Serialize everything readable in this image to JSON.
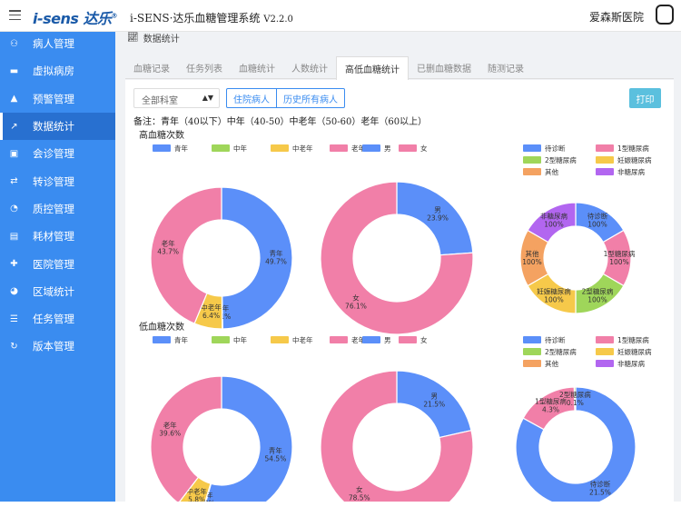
{
  "header": {
    "logo_text": "i-sens",
    "logo_cn": "达乐",
    "app_title": "i-SENS·达乐血糖管理系统",
    "version": "V2.2.0",
    "hospital": "爱森斯医院"
  },
  "sidebar": {
    "items": [
      {
        "label": "病人管理",
        "icon": "users-icon"
      },
      {
        "label": "虚拟病房",
        "icon": "bed-icon"
      },
      {
        "label": "预警管理",
        "icon": "bell-icon"
      },
      {
        "label": "数据统计",
        "icon": "chart-line-icon",
        "active": true
      },
      {
        "label": "会诊管理",
        "icon": "briefcase-icon"
      },
      {
        "label": "转诊管理",
        "icon": "exchange-icon"
      },
      {
        "label": "质控管理",
        "icon": "gauge-icon"
      },
      {
        "label": "耗材管理",
        "icon": "box-icon"
      },
      {
        "label": "医院管理",
        "icon": "hospital-icon"
      },
      {
        "label": "区域统计",
        "icon": "pie-icon"
      },
      {
        "label": "任务管理",
        "icon": "list-icon"
      },
      {
        "label": "版本管理",
        "icon": "refresh-icon"
      }
    ]
  },
  "breadcrumb": "数据统计",
  "tabs": [
    "血糖记录",
    "任务列表",
    "血糖统计",
    "人数统计",
    "高低血糖统计",
    "已删血糖数据",
    "随测记录"
  ],
  "active_tab": 4,
  "filters": {
    "dept_select": "全部科室",
    "btn_inpatient": "住院病人",
    "btn_history": "历史所有病人",
    "btn_print": "打印"
  },
  "note": "备注：青年（40以下）中年（40-50）中老年（50-60）老年（60以上）",
  "section_high": "高血糖次数",
  "section_low": "低血糖次数",
  "colors": {
    "blue": "#5b8ff9",
    "green": "#9fd65a",
    "yellow": "#f6c94a",
    "pink": "#f17fa8",
    "orange": "#f4a261",
    "purple": "#b266f0"
  },
  "chart_data": [
    {
      "type": "pie",
      "title": "高血糖次数",
      "legend": [
        "青年",
        "中年",
        "中老年",
        "老年"
      ],
      "slices": [
        {
          "name": "青年",
          "value": 49.7,
          "label": "青年\n49.7%"
        },
        {
          "name": "中年",
          "value": 0.1,
          "label": "中年\n0.1%"
        },
        {
          "name": "中老年",
          "value": 6.4,
          "label": "中老年\n6.4%"
        },
        {
          "name": "老年",
          "value": 43.7,
          "label": "老年\n43.7%"
        }
      ]
    },
    {
      "type": "pie",
      "legend": [
        "男",
        "女"
      ],
      "slices": [
        {
          "name": "男",
          "value": 23.9,
          "label": "男\n23.9%"
        },
        {
          "name": "女",
          "value": 76.1,
          "label": "女\n76.1%"
        }
      ]
    },
    {
      "type": "pie",
      "legend": [
        "待诊断",
        "1型糖尿病",
        "2型糖尿病",
        "妊娠糖尿病",
        "其他",
        "非糖尿病"
      ],
      "slices": [
        {
          "name": "待诊断",
          "value": 100,
          "label": "待诊断\n100%"
        },
        {
          "name": "1型糖尿病",
          "value": 100,
          "label": "1型糖尿病\n100%"
        },
        {
          "name": "2型糖尿病",
          "value": 100,
          "label": "2型糖尿病\n100%"
        },
        {
          "name": "妊娠糖尿病",
          "value": 100,
          "label": "妊娠糖尿病\n100%"
        },
        {
          "name": "其他",
          "value": 100,
          "label": "其他\n100%"
        },
        {
          "name": "非糖尿病",
          "value": 100,
          "label": "非糖尿病\n100%"
        }
      ]
    },
    {
      "type": "pie",
      "title": "低血糖次数",
      "legend": [
        "青年",
        "中年",
        "中老年",
        "老年"
      ],
      "slices": [
        {
          "name": "青年",
          "value": 54.5,
          "label": "青年\n54.5%"
        },
        {
          "name": "中年",
          "value": 0.2,
          "label": "中年\n0.2%"
        },
        {
          "name": "中老年",
          "value": 5.8,
          "label": "中老年\n5.8%"
        },
        {
          "name": "老年",
          "value": 39.6,
          "label": "老年\n39.6%"
        }
      ]
    },
    {
      "type": "pie",
      "legend": [
        "男",
        "女"
      ],
      "slices": [
        {
          "name": "男",
          "value": 21.5,
          "label": "男\n21.5%"
        },
        {
          "name": "女",
          "value": 78.5,
          "label": "女\n78.5%"
        }
      ]
    },
    {
      "type": "pie",
      "legend": [
        "待诊断",
        "1型糖尿病",
        "2型糖尿病",
        "妊娠糖尿病",
        "其他",
        "非糖尿病"
      ],
      "slices": [
        {
          "name": "待诊断",
          "value": 21.5,
          "label": "待诊断\n21.5%"
        },
        {
          "name": "1型糖尿病",
          "value": 4.3,
          "label": "1型糖尿病\n4.3%"
        },
        {
          "name": "2型糖尿病",
          "value": 0.1,
          "label": "2型糖尿病\n0.1%"
        }
      ]
    }
  ]
}
